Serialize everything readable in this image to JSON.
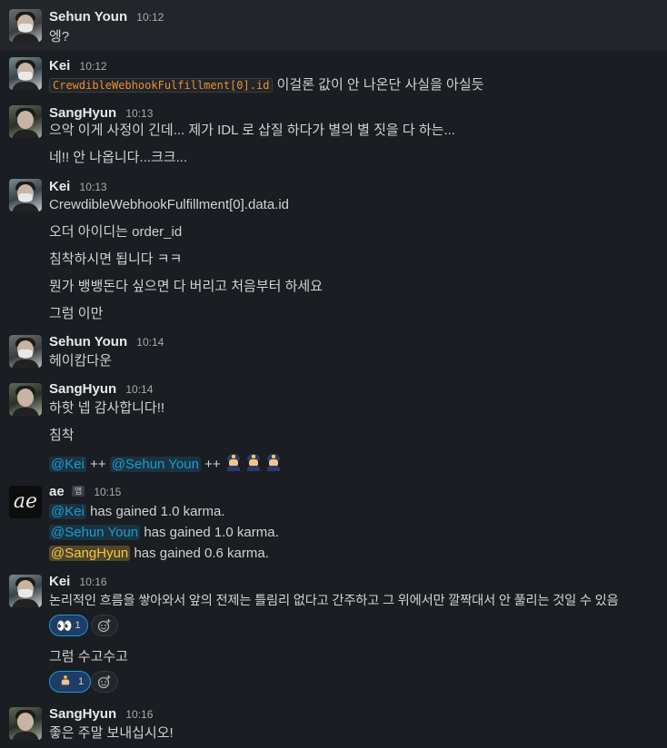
{
  "messages": [
    {
      "author": "Sehun Youn",
      "time": "10:12",
      "lines": [
        "엥?"
      ]
    },
    {
      "author": "Kei",
      "time": "10:12",
      "code": "CrewdibleWebhookFulfillment[0].id",
      "after_code": "이걸론 값이 안 나온단 사실을 아실듯"
    },
    {
      "author": "SangHyun",
      "time": "10:13",
      "lines": [
        "으악 이게 사정이 긴데... 제가 IDL 로 삽질 하다가 별의 별 짓을 다 하는...",
        "네!! 안 나옵니다...크크..."
      ]
    },
    {
      "author": "Kei",
      "time": "10:13",
      "lines": [
        "CrewdibleWebhookFulfillment[0].data.id",
        "오더 아이디는 order_id",
        "침착하시면 됩니다 ㅋㅋ",
        "뭔가 뱅뱅돈다 싶으면 다 버리고 처음부터 하세요",
        "그럼 이만"
      ]
    },
    {
      "author": "Sehun Youn",
      "time": "10:14",
      "lines": [
        "헤이캄다운"
      ]
    },
    {
      "author": "SangHyun",
      "time": "10:14",
      "lines": [
        "하핫 넵 감사합니다!!",
        "침착"
      ],
      "mentions_line": {
        "m1": "@Kei",
        "sep1": "++",
        "m2": "@Sehun Youn",
        "sep2": "++"
      }
    },
    {
      "author": "ae",
      "app_badge": "앱",
      "time": "10:15",
      "karma": [
        {
          "mention": "@Kei",
          "text": "has gained 1.0 karma."
        },
        {
          "mention": "@Sehun Youn",
          "text": "has gained 1.0 karma."
        },
        {
          "mention": "@SangHyun",
          "text": "has gained 0.6 karma."
        }
      ]
    },
    {
      "author": "Kei",
      "time": "10:16",
      "lines": [
        "논리적인 흐름을 쌓아와서 앞의 전제는 틀림리 없다고 간주하고 그 위에서만 깔짝대서 안 풀리는 것일 수 있음",
        "그럼 수고수고"
      ],
      "reactions": [
        {
          "icon": "eyes-icon",
          "count": "1"
        },
        {
          "icon": "police-officer-icon",
          "count": "1"
        }
      ]
    },
    {
      "author": "SangHyun",
      "time": "10:16",
      "lines": [
        "좋은 주말 보내십시오!"
      ]
    }
  ],
  "avatar_logo": "ae",
  "colors": {
    "background": "#1a1d21",
    "mention": "#1d9bd1",
    "self_mention": "#f2c744",
    "code": "#e8912d"
  }
}
